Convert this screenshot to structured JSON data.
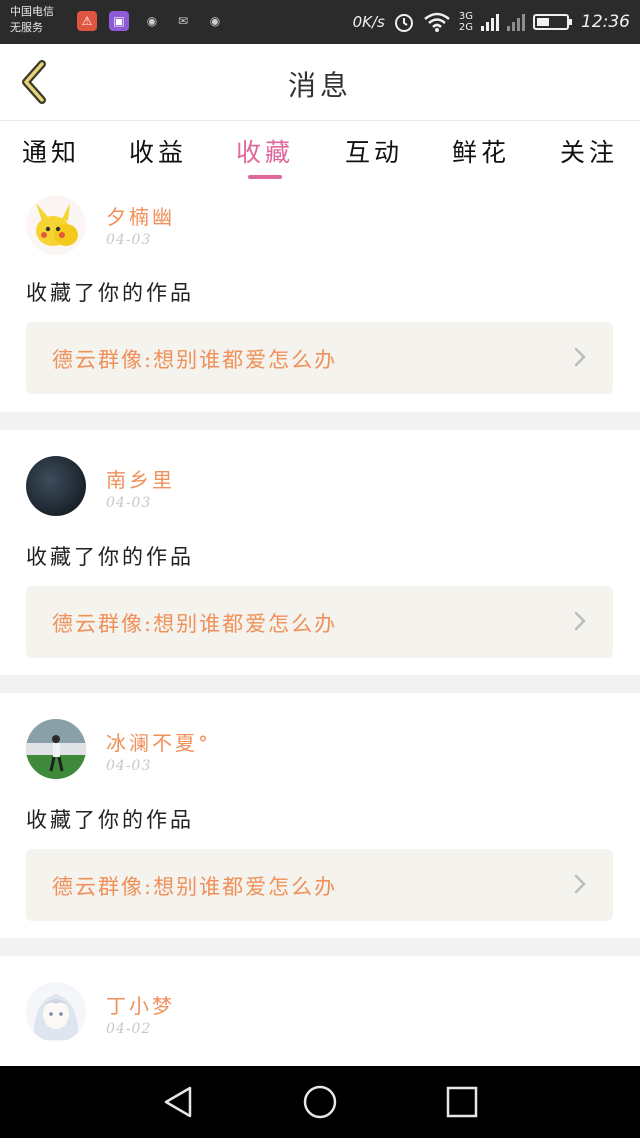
{
  "status_bar": {
    "carrier_line1": "中国电信",
    "carrier_line2": "无服务",
    "speed": "0K/s",
    "network_3g": "3G",
    "network_2g": "2G",
    "time": "12:36",
    "battery_level": 0.45,
    "icons": [
      "warning-icon",
      "image-app-icon",
      "weibo-icon",
      "mail-icon",
      "weibo-icon",
      "alarm-icon",
      "wifi-icon",
      "signal-icon",
      "battery-icon"
    ]
  },
  "header": {
    "title": "消息",
    "back_icon": "chevron-left-icon"
  },
  "tabs": [
    {
      "label": "通知",
      "active": false
    },
    {
      "label": "收益",
      "active": false
    },
    {
      "label": "收藏",
      "active": true
    },
    {
      "label": "互动",
      "active": false
    },
    {
      "label": "鲜花",
      "active": false
    },
    {
      "label": "关注",
      "active": false
    }
  ],
  "messages": [
    {
      "username": "夕楠幽",
      "date": "04-03",
      "action": "收藏了你的作品",
      "work_title": "德云群像:想别谁都爱怎么办",
      "avatar": "pikachu-avatar"
    },
    {
      "username": "南乡里",
      "date": "04-03",
      "action": "收藏了你的作品",
      "work_title": "德云群像:想别谁都爱怎么办",
      "avatar": "dark-avatar"
    },
    {
      "username": "冰澜不夏°",
      "date": "04-03",
      "action": "收藏了你的作品",
      "work_title": "德云群像:想别谁都爱怎么办",
      "avatar": "photo-avatar"
    },
    {
      "username": "丁小梦",
      "date": "04-02",
      "action": "",
      "work_title": "",
      "avatar": "anime-avatar"
    }
  ],
  "nav_bar": {
    "icons": [
      "back-triangle-icon",
      "home-circle-icon",
      "recents-square-icon"
    ]
  },
  "colors": {
    "accent": "#e0679c",
    "username": "#f0905a",
    "card_bg": "#f4f3ee"
  }
}
